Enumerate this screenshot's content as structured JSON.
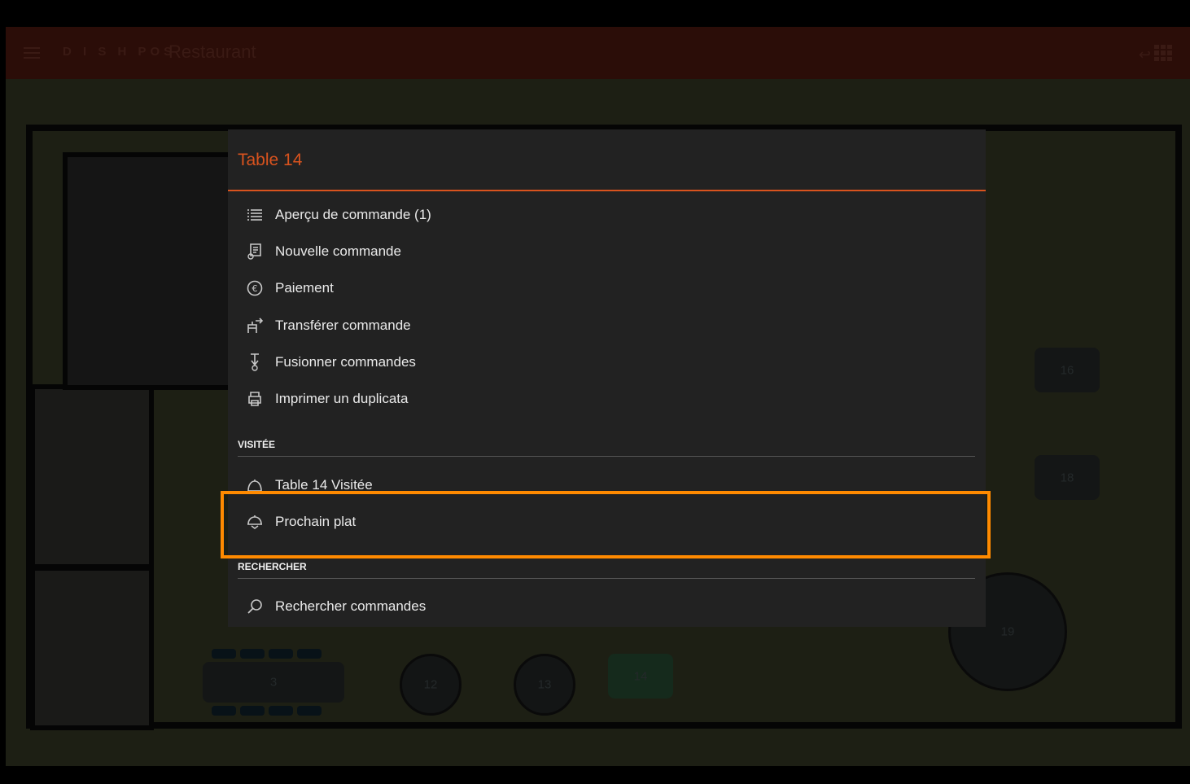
{
  "app": {
    "brand": "D I S H POS",
    "title": "Restaurant"
  },
  "floor": {
    "tables": [
      {
        "label": "3"
      },
      {
        "label": "12"
      },
      {
        "label": "13"
      },
      {
        "label": "14"
      },
      {
        "label": "16"
      },
      {
        "label": "18"
      },
      {
        "label": "19"
      }
    ]
  },
  "dialog": {
    "title": "Table 14",
    "actions": [
      {
        "icon": "list-icon",
        "label": "Aperçu de commande (1)"
      },
      {
        "icon": "receipt-icon",
        "label": "Nouvelle commande"
      },
      {
        "icon": "euro-icon",
        "label": "Paiement"
      },
      {
        "icon": "transfer-chair-icon",
        "label": "Transférer commande"
      },
      {
        "icon": "merge-icon",
        "label": "Fusionner commandes"
      },
      {
        "icon": "printer-icon",
        "label": "Imprimer un duplicata"
      }
    ],
    "section_visited": "VISITÉE",
    "visited_items": [
      {
        "icon": "bell-icon",
        "label": "Table 14 Visitée"
      },
      {
        "icon": "cloche-icon",
        "label": "Prochain plat"
      }
    ],
    "section_search": "RECHERCHER",
    "search_items": [
      {
        "icon": "search-icon",
        "label": "Rechercher commandes"
      }
    ]
  },
  "colors": {
    "accent": "#d9531e",
    "highlight": "#ff8a00",
    "dialog_bg": "#222222"
  }
}
